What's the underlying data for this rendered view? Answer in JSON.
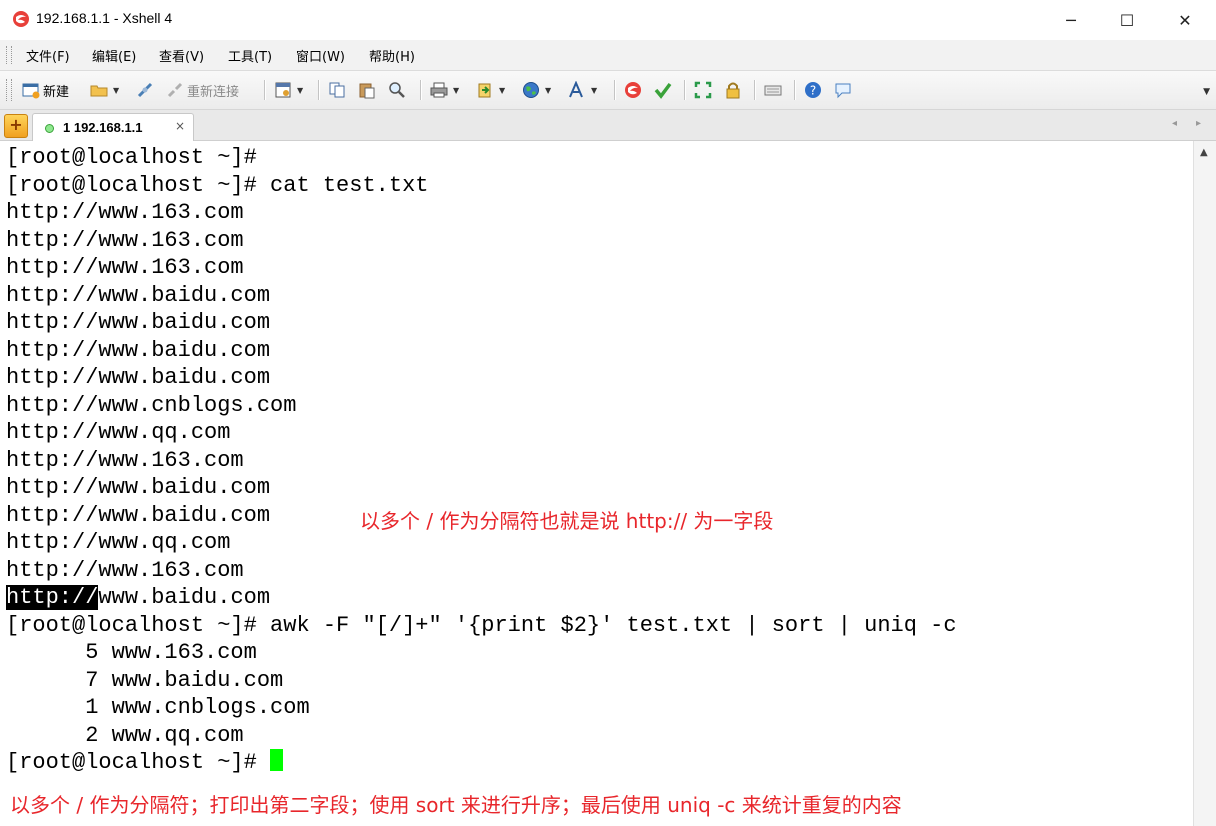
{
  "window": {
    "title": "192.168.1.1 - Xshell 4",
    "controls": {
      "minimize": "─",
      "maximize": "☐",
      "close": "✕"
    }
  },
  "menu": [
    "文件(F)",
    "编辑(E)",
    "查看(V)",
    "工具(T)",
    "窗口(W)",
    "帮助(H)"
  ],
  "toolbar": {
    "new_label": "新建",
    "reconnect_label": "重新连接"
  },
  "tabs": {
    "active_label": "1 192.168.1.1",
    "close_glyph": "×",
    "nav_left": "◂",
    "nav_right": "▸"
  },
  "terminal": {
    "lines": [
      "[root@localhost ~]#",
      "[root@localhost ~]# cat test.txt",
      "http://www.163.com",
      "http://www.163.com",
      "http://www.163.com",
      "http://www.baidu.com",
      "http://www.baidu.com",
      "http://www.baidu.com",
      "http://www.baidu.com",
      "http://www.cnblogs.com",
      "http://www.qq.com",
      "http://www.163.com",
      "http://www.baidu.com",
      "http://www.baidu.com",
      "http://www.qq.com",
      "http://www.163.com"
    ],
    "selected_prefix": "http://",
    "selected_rest": "www.baidu.com",
    "awk_command": "[root@localhost ~]# awk -F \"[/]+\" '{print $2}' test.txt | sort | uniq -c",
    "results": [
      "      5 www.163.com",
      "      7 www.baidu.com",
      "      1 www.cnblogs.com",
      "      2 www.qq.com"
    ],
    "prompt": "[root@localhost ~]# ",
    "cursor_color": "#00ff00"
  },
  "annotations": {
    "field_note": "以多个 / 作为分隔符也就是说 http:// 为一字段",
    "summary_note": "以多个 / 作为分隔符；打印出第二字段；使用 sort 来进行升序；最后使用 uniq -c 来统计重复的内容",
    "color": "#e8262b"
  }
}
